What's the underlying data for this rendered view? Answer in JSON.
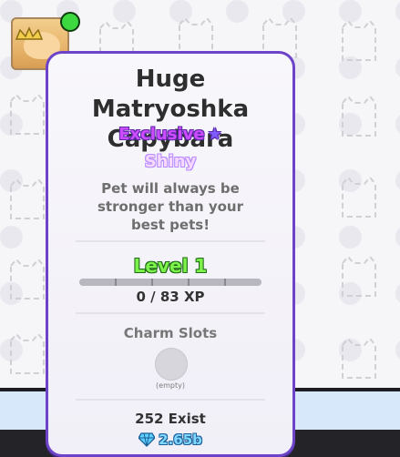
{
  "card": {
    "title": "Huge Matryoshka Capybara",
    "rarity": "Exclusive",
    "rarity_icon": "star",
    "variant": "Shiny",
    "description": "Pet will always be stronger than your best pets!"
  },
  "level": {
    "label": "Level 1",
    "xp": "0 / 83 XP",
    "progress": 0
  },
  "charms": {
    "title": "Charm Slots",
    "slot_text": "(empty)"
  },
  "stats": {
    "exist": "252 Exist",
    "value": "2.65b",
    "value_icon": "diamond-icon"
  },
  "colors": {
    "card_border": "#6d44c9",
    "rarity": "#ce4cff",
    "level": "#7cf24b",
    "value": "#7fd8ff",
    "online": "#3dd83f"
  }
}
